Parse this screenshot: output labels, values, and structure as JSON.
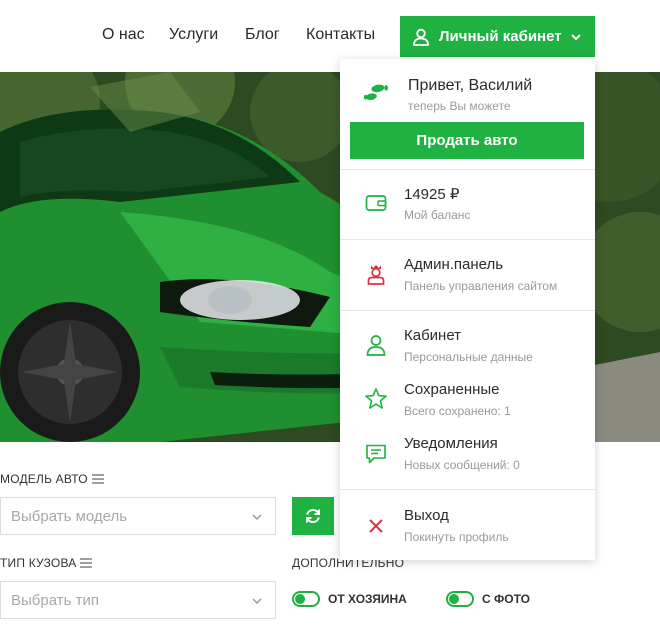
{
  "nav": {
    "links": [
      {
        "label": "О нас"
      },
      {
        "label": "Услуги"
      },
      {
        "label": "Блог"
      },
      {
        "label": "Контакты"
      }
    ],
    "account_button": "Личный кабинет"
  },
  "menu": {
    "greeting": "Привет, Василий",
    "greeting_sub": "теперь Вы можете",
    "sell_button": "Продать авто",
    "balance": {
      "title": "14925 ₽",
      "sub": "Мой баланс"
    },
    "admin": {
      "title": "Админ.панель",
      "sub": "Панель управления сайтом"
    },
    "cabinet": {
      "title": "Кабинет",
      "sub": "Персональные данные"
    },
    "saved": {
      "title": "Сохраненные",
      "sub": "Всего сохранено: 1"
    },
    "notifications": {
      "title": "Уведомления",
      "sub": "Новых сообщений: 0"
    },
    "logout": {
      "title": "Выход",
      "sub": "Покинуть профиль"
    }
  },
  "filters": {
    "model_label": "МОДЕЛЬ АВТО",
    "model_placeholder": "Выбрать модель",
    "body_label": "ТИП КУЗОВА",
    "body_placeholder": "Выбрать тип",
    "extra_label": "ДОПОЛНИТЕЛЬНО",
    "owner_toggle": "ОТ ХОЗЯИНА",
    "photo_toggle": "С ФОТО"
  },
  "colors": {
    "accent": "#1fb141",
    "danger": "#d9333f"
  }
}
